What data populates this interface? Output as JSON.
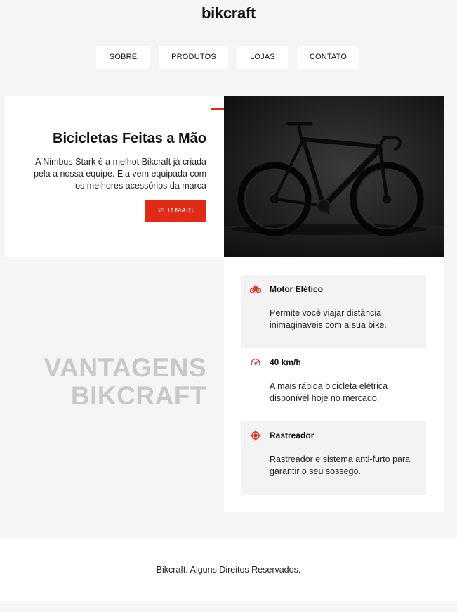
{
  "header": {
    "logo": "bikcraft"
  },
  "nav": {
    "items": [
      {
        "label": "SOBRE"
      },
      {
        "label": "PRODUTOS"
      },
      {
        "label": "LOJAS"
      },
      {
        "label": "CONTATO"
      }
    ]
  },
  "hero": {
    "title": "Bicicletas Feitas a Mão",
    "text": "A Nimbus Stark é a melhot Bikcraft já criada pela a nossa equipe. Ela vem equipada com os melhores acessórios da marca",
    "button": "VER MAIS",
    "image_icon": "bicycle-photo"
  },
  "vantagens": {
    "line1": "VANTAGENS",
    "line2": "BIKCRAFT"
  },
  "features": [
    {
      "icon": "bike-icon",
      "title": "Motor Elético",
      "text": "Permite você viajar distância inimaginaveis com a sua bike."
    },
    {
      "icon": "speedometer-icon",
      "title": "40 km/h",
      "text": "A mais rápida bicicleta elétrica disponível hoje no mercado."
    },
    {
      "icon": "target-icon",
      "title": "Rastreador",
      "text": "Rastreador e sistema anti-furto para garantir o seu sossego."
    }
  ],
  "footer": {
    "text": "Bikcraft. Alguns Direitos Reservados."
  },
  "colors": {
    "accent": "#e22b16",
    "background": "#f5f5f5",
    "vantagens": "#c8c8c8"
  }
}
